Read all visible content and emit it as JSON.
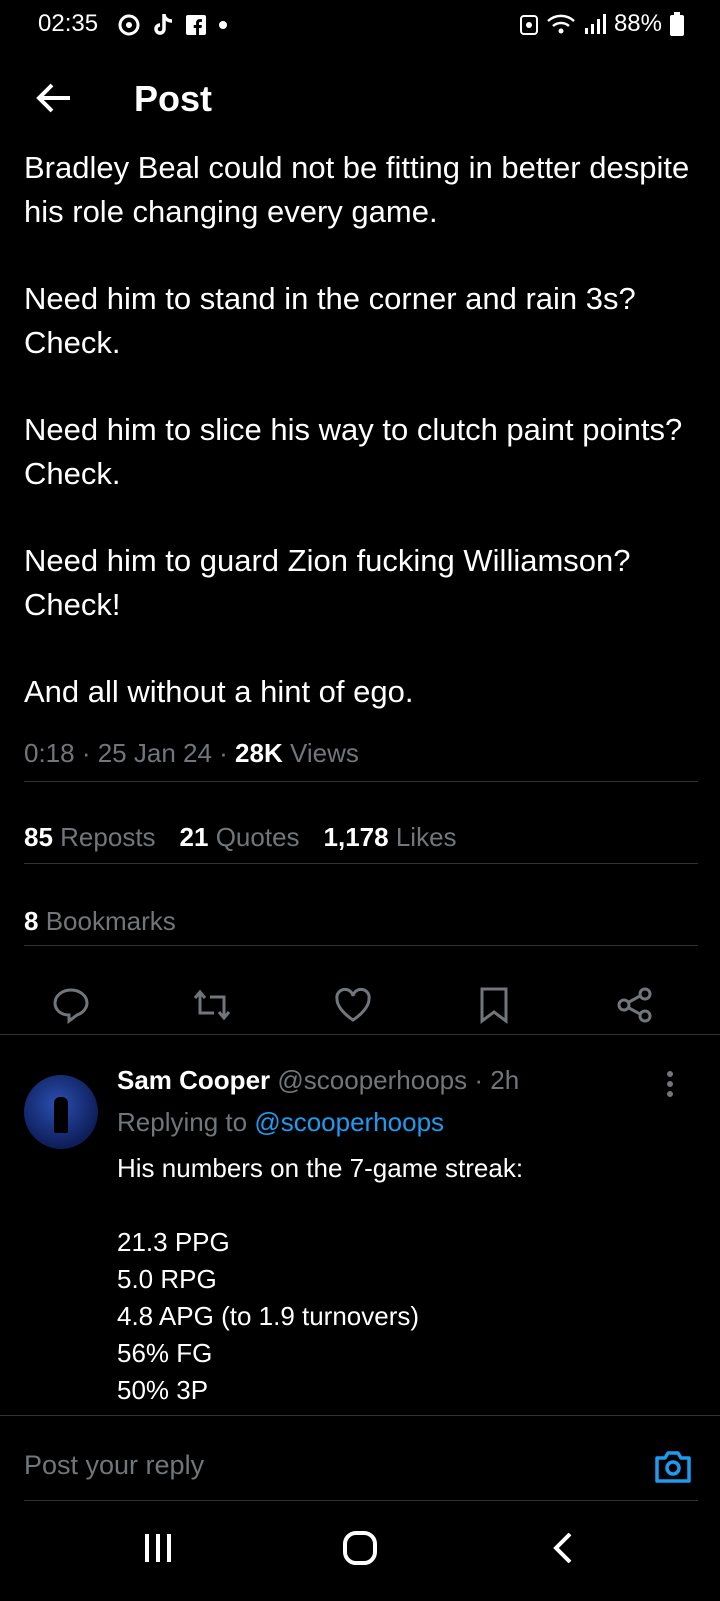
{
  "status": {
    "time": "02:35",
    "battery": "88%",
    "icons": [
      "chrome-icon",
      "tiktok-icon",
      "facebook-icon",
      "dot-icon",
      "recycle-icon",
      "wifi-icon",
      "signal-icon",
      "battery-icon"
    ]
  },
  "header": {
    "title": "Post"
  },
  "post": {
    "paragraphs": [
      "Bradley Beal could not be fitting in better despite his role changing every game.",
      "Need him to stand in the corner and rain 3s? Check.",
      "Need him to slice his way to clutch paint points? Check.",
      "Need him to guard Zion fucking Williamson? Check!",
      "And all without a hint of ego."
    ],
    "time": "0:18",
    "date": "25 Jan 24",
    "views_count": "28K",
    "views_label": "Views",
    "reposts_count": "85",
    "reposts_label": "Reposts",
    "quotes_count": "21",
    "quotes_label": "Quotes",
    "likes_count": "1,178",
    "likes_label": "Likes",
    "bookmarks_count": "8",
    "bookmarks_label": "Bookmarks"
  },
  "reply": {
    "name": "Sam Cooper",
    "handle": "@scooperhoops",
    "age": "· 2h",
    "replying_label": "Replying to",
    "replying_to": "@scooperhoops",
    "text": "His numbers on the 7-game streak:\n\n21.3 PPG\n5.0 RPG\n4.8 APG (to 1.9 turnovers)\n56% FG\n50% 3P"
  },
  "composer": {
    "placeholder": "Post your reply"
  },
  "colors": {
    "accent": "#1d9bf0",
    "muted": "#71767b",
    "divider": "#2f3336"
  }
}
